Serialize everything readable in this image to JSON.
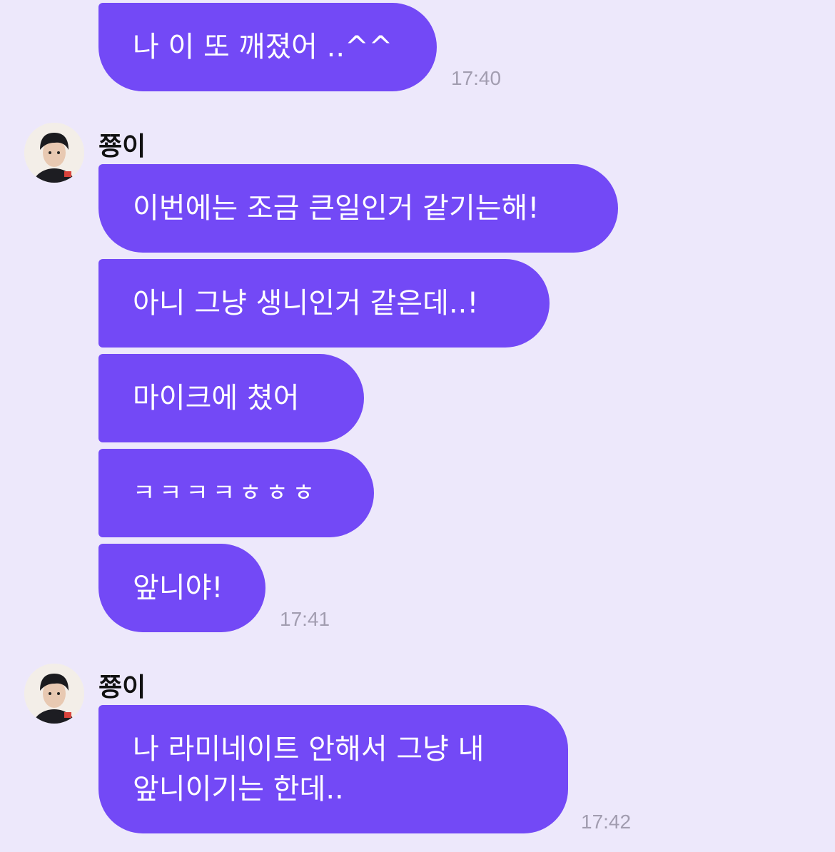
{
  "colors": {
    "background": "#EDE8FB",
    "bubble": "#7349F6",
    "bubble_text": "#FFFFFF",
    "timestamp": "#A29DB0"
  },
  "groups": [
    {
      "messages": [
        "나 이 또 깨졌어 ..^^"
      ],
      "time": "17:40"
    },
    {
      "sender": "쭁이",
      "avatar_icon": "profile-photo",
      "messages": [
        "이번에는 조금 큰일인거 같기는해!",
        "아니 그냥 생니인거 같은데..!",
        "마이크에 쳤어",
        "ㅋㅋㅋㅋㅎㅎㅎ",
        "앞니야!"
      ],
      "time": "17:41"
    },
    {
      "sender": "쭁이",
      "avatar_icon": "profile-photo",
      "message_lines": [
        "나 라미네이트 안해서 그냥 내",
        "앞니이기는 한데.."
      ],
      "time": "17:42"
    }
  ]
}
